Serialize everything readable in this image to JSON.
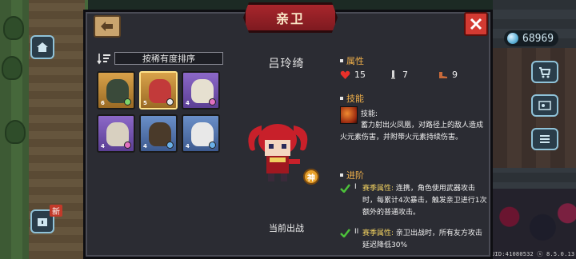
{
  "window": {
    "title": "亲卫"
  },
  "hud": {
    "gem_count": "68969",
    "new_badge": "新",
    "uid": "UID:41080532 ⓢ 8.5.0.13"
  },
  "sort": {
    "label": "按稀有度排序"
  },
  "roster": [
    {
      "rarity": "gold",
      "level": "6",
      "element_color": "#7dd36a",
      "selected": false
    },
    {
      "rarity": "gold",
      "level": "5",
      "element_color": "#e6e6e6",
      "selected": true
    },
    {
      "rarity": "purple",
      "level": "4",
      "element_color": "#e070c0",
      "selected": false
    },
    {
      "rarity": "purple",
      "level": "4",
      "element_color": "#e070c0",
      "selected": false
    },
    {
      "rarity": "blue",
      "level": "4",
      "element_color": "#6ab0e8",
      "selected": false
    },
    {
      "rarity": "blue",
      "level": "4",
      "element_color": "#6ab0e8",
      "selected": false
    }
  ],
  "hero": {
    "name": "吕玲绮",
    "tag": "神",
    "deploy_label": "当前出战"
  },
  "attributes": {
    "title": "属性",
    "health": "15",
    "armor": "7",
    "speed": "9"
  },
  "skill": {
    "title": "技能",
    "label": "技能:",
    "description": "蓄力射出火凤凰，对路径上的敌人造成火元素伤害，并附带火元素持续伤害。"
  },
  "advance": {
    "title": "进阶",
    "items": [
      {
        "mark": "I",
        "key": "赛季属性:",
        "text": "连携，角色使用武器攻击时，每累计4次暴击，触发亲卫进行1次额外的普通攻击。"
      },
      {
        "mark": "II",
        "key": "赛季属性:",
        "text": "亲卫出战时，所有友方攻击延迟降低30%"
      }
    ]
  },
  "colors": {
    "accent_orange": "#f0b04a",
    "title_red": "#a8262c",
    "close_red": "#d33a32",
    "check_green": "#4cc23a"
  }
}
